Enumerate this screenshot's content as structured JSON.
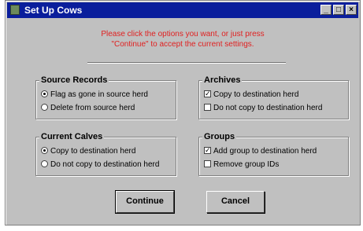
{
  "window": {
    "title": "Set Up Cows"
  },
  "instructions": {
    "line1": "Please click the options you want, or just press",
    "line2": "\"Continue\" to accept the current settings."
  },
  "groups": {
    "source_records": {
      "title": "Source Records",
      "options": [
        "Flag as gone in source herd",
        "Delete from source herd"
      ],
      "selected": 0
    },
    "archives": {
      "title": "Archives",
      "options": [
        "Copy to destination herd",
        "Do not copy to destination herd"
      ],
      "checked": [
        true,
        false
      ]
    },
    "current_calves": {
      "title": "Current Calves",
      "options": [
        "Copy to destination herd",
        "Do not copy to destination herd"
      ],
      "selected": 0
    },
    "groups": {
      "title": "Groups",
      "options": [
        "Add group to destination herd",
        "Remove group IDs"
      ],
      "checked": [
        true,
        false
      ]
    }
  },
  "buttons": {
    "continue": "Continue",
    "cancel": "Cancel"
  },
  "icons": {
    "window": "app-icon",
    "minimize": "minimize-icon",
    "maximize": "maximize-icon",
    "close": "close-icon"
  }
}
